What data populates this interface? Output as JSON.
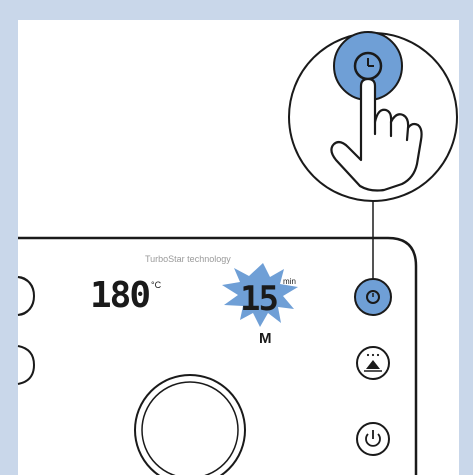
{
  "colors": {
    "frame": "#c9d7ea",
    "panel": "#ffffff",
    "line": "#1a1a1a",
    "accent_blue": "#6f9fd6",
    "text_gray": "#9a9a9a"
  },
  "panel": {
    "brand_text": "TurboStar technology"
  },
  "display": {
    "temperature": "180",
    "temperature_unit": "°C",
    "timer": "15",
    "timer_unit": "min",
    "mode_letter": "M"
  },
  "buttons": [
    {
      "id": "timer",
      "icon": "clock-icon",
      "highlighted": true
    },
    {
      "id": "preset",
      "icon": "preset-icon",
      "highlighted": false
    },
    {
      "id": "power",
      "icon": "power-icon",
      "highlighted": false
    }
  ],
  "callout": {
    "icon": "clock-icon",
    "gesture": "hand-press-icon"
  }
}
